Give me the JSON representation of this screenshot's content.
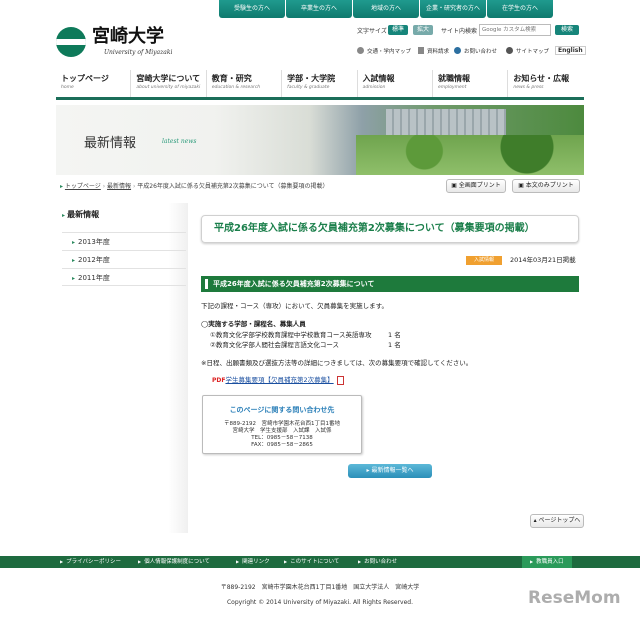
{
  "audience_links": [
    "受験生の方へ",
    "卒業生の方へ",
    "地域の方へ",
    "企業・研究者の方へ",
    "在学生の方へ"
  ],
  "logo": {
    "title": "宮崎大学",
    "subtitle": "University of Miyazaki"
  },
  "header_tools": {
    "font_size_label": "文字サイズ",
    "font_standard": "標準",
    "font_large": "拡大",
    "search_label": "サイト内検索",
    "search_placeholder": "Google カスタム検索",
    "search_button": "検索"
  },
  "utility_links": [
    "交通・学内マップ",
    "資料請求",
    "お問い合わせ",
    "サイトマップ",
    "English"
  ],
  "nav": [
    {
      "ja": "トップページ",
      "en": "home"
    },
    {
      "ja": "宮崎大学について",
      "en": "about university of miyazaki"
    },
    {
      "ja": "教育・研究",
      "en": "education & research"
    },
    {
      "ja": "学部・大学院",
      "en": "faculty & graduate"
    },
    {
      "ja": "入試情報",
      "en": "admission"
    },
    {
      "ja": "就職情報",
      "en": "employment"
    },
    {
      "ja": "お知らせ・広報",
      "en": "news & press"
    }
  ],
  "hero": {
    "title": "最新情報",
    "subtitle": "latest news"
  },
  "breadcrumb": {
    "home": "トップページ",
    "section": "最新情報",
    "current": "平成26年度入試に係る欠員補充第2次募集について（募集要項の掲載）"
  },
  "print_buttons": {
    "full": "全画面プリント",
    "content": "本文のみプリント"
  },
  "sidebar": {
    "heading": "最新情報",
    "items": [
      "2013年度",
      "2012年度",
      "2011年度"
    ]
  },
  "article": {
    "title": "平成26年度入試に係る欠員補充第2次募集について（募集要項の掲載）",
    "category": "入試情報",
    "date": "2014年03月21日掲載",
    "section_heading": "平成26年度入試に係る欠員補充第2次募集について",
    "intro": "下記の課程・コース（専攻）において、欠員募集を実施します。",
    "list_heading": "◯実施する学部・課程名、募集人員",
    "items": [
      {
        "text": "①教育文化学部学校教育課程中学校教育コース英語専攻",
        "count": "1 名"
      },
      {
        "text": "②教育文化学部人間社会課程言語文化コース",
        "count": "1 名"
      }
    ],
    "note": "※日程、出願書類及び選抜方法等の詳細につきましては、次の募集要項で確認してください。",
    "pdf_link": "学生募集要項【欠員補充第2次募集】"
  },
  "contact": {
    "title": "このページに関する問い合わせ先",
    "address": "〒889-2192　宮崎市学園木花台西1丁目1番地",
    "dept": "宮崎大学　学生支援部　入試課　入試係",
    "tel": "TEL：0985－58－7138",
    "fax": "FAX：0985－58－2865"
  },
  "list_button": "最新情報一覧へ",
  "page_top": "ページトップへ",
  "footer_links": [
    "プライバシーポリシー",
    "個人情報保護制度について",
    "関連リンク",
    "このサイトについて",
    "お問い合わせ"
  ],
  "staff_entrance": "教職員入口",
  "footer": {
    "address": "〒889-2192　宮崎市学園木花台西1丁目1番地　国立大学法人　宮崎大学",
    "copyright": "Copyright © 2014 University of Miyazaki. All Rights Reserved."
  },
  "watermark": "ReseMom"
}
